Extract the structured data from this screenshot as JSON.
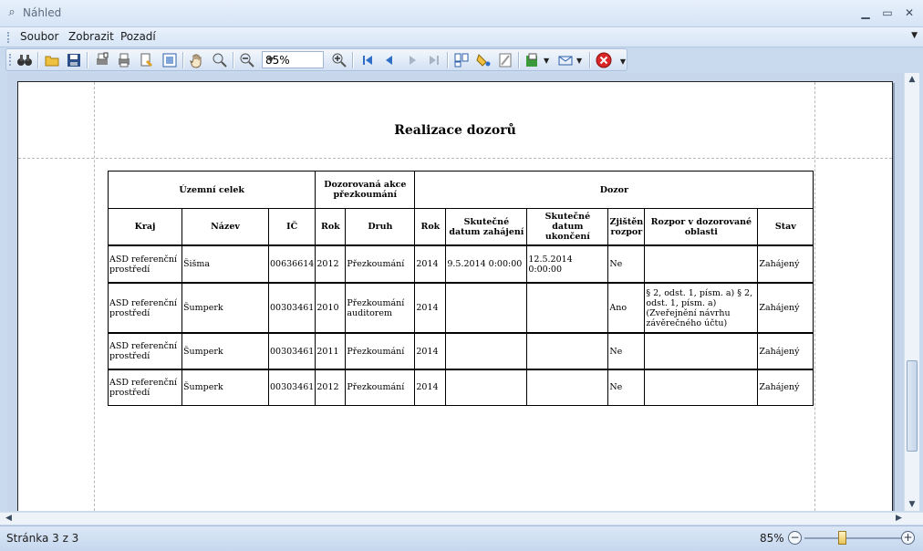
{
  "window": {
    "title": "Náhled"
  },
  "menu": {
    "items": [
      "Soubor",
      "Zobrazit",
      "Pozadí"
    ]
  },
  "toolbar": {
    "zoom_value": "85%"
  },
  "report": {
    "title": "Realizace dozorů",
    "group_headers": [
      "Územní celek",
      "Dozorovaná akce přezkoumání",
      "Dozor"
    ],
    "columns": [
      "Kraj",
      "Název",
      "IČ",
      "Rok",
      "Druh",
      "Rok",
      "Skutečné datum zahájení",
      "Skutečné datum ukončení",
      "Zjištěn rozpor",
      "Rozpor v dozorované oblasti",
      "Stav"
    ],
    "rows": [
      [
        "ASD referenční prostředí",
        "Šišma",
        "00636614",
        "2012",
        "Přezkoumání",
        "2014",
        "9.5.2014 0:00:00",
        "12.5.2014 0:00:00",
        "Ne",
        "",
        "Zahájený"
      ],
      [
        "ASD referenční prostředí",
        "Šumperk",
        "00303461",
        "2010",
        "Přezkoumání auditorem",
        "2014",
        "",
        "",
        "Ano",
        "§ 2, odst. 1, písm. a) § 2, odst. 1, písm. a) (Zveřejnění návrhu závěrečného účtu)",
        "Zahájený"
      ],
      [
        "ASD referenční prostředí",
        "Šumperk",
        "00303461",
        "2011",
        "Přezkoumání",
        "2014",
        "",
        "",
        "Ne",
        "",
        "Zahájený"
      ],
      [
        "ASD referenční prostředí",
        "Šumperk",
        "00303461",
        "2012",
        "Přezkoumání",
        "2014",
        "",
        "",
        "Ne",
        "",
        "Zahájený"
      ]
    ]
  },
  "status": {
    "page_info": "Stránka 3 z 3",
    "zoom": "85%"
  },
  "icons": [
    "find-icon",
    "open-icon",
    "save-icon",
    "print-setup-icon",
    "print-icon",
    "quick-print-icon",
    "page-setup-icon",
    "hand-tool-icon",
    "magnifier-icon",
    "zoom-out-icon",
    "zoom-in-icon",
    "first-page-icon",
    "previous-page-icon",
    "next-page-icon",
    "last-page-icon",
    "multiple-pages-icon",
    "color-icon",
    "watermark-icon",
    "export-icon",
    "email-icon",
    "close-preview-icon"
  ]
}
